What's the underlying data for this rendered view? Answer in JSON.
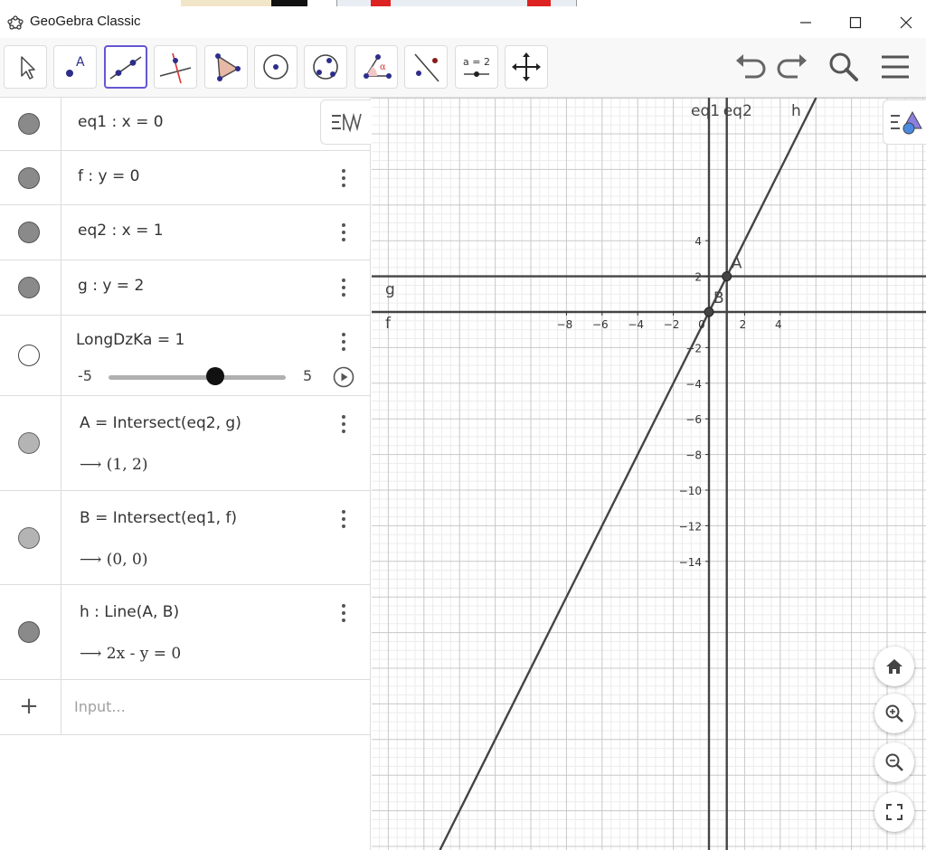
{
  "window": {
    "title": "GeoGebra Classic",
    "controls": [
      "minimize",
      "maximize",
      "close"
    ]
  },
  "toolbar": {
    "tools": [
      {
        "name": "move",
        "icon": "move-arrow-icon"
      },
      {
        "name": "point",
        "icon": "point-icon",
        "label": "A"
      },
      {
        "name": "line",
        "icon": "line-through-two-points-icon",
        "selected": true
      },
      {
        "name": "perpendicular-line",
        "icon": "perpendicular-line-icon"
      },
      {
        "name": "polygon",
        "icon": "polygon-icon"
      },
      {
        "name": "circle-center-point",
        "icon": "circle-icon"
      },
      {
        "name": "circle-three-points",
        "icon": "circle-three-points-icon"
      },
      {
        "name": "angle",
        "icon": "angle-icon",
        "label": "α"
      },
      {
        "name": "reflect-about-line",
        "icon": "reflect-icon"
      },
      {
        "name": "slider",
        "icon": "slider-icon",
        "label": "a = 2"
      },
      {
        "name": "move-graphics-view",
        "icon": "move-graphics-icon"
      }
    ],
    "right": [
      "undo",
      "redo",
      "search",
      "menu"
    ]
  },
  "algebra": {
    "rows": [
      {
        "id": "eq1",
        "expr": "eq1 : x = 0",
        "marble": "dark"
      },
      {
        "id": "f",
        "expr": "f : y = 0",
        "marble": "dark"
      },
      {
        "id": "eq2",
        "expr": "eq2 : x = 1",
        "marble": "dark"
      },
      {
        "id": "g",
        "expr": "g : y = 2",
        "marble": "dark"
      },
      {
        "id": "slider",
        "expr": "LongDzKa = 1",
        "marble": "empty",
        "slider": {
          "min": "-5",
          "max": "5",
          "value": 1,
          "min_value": -5,
          "max_value": 5
        }
      },
      {
        "id": "A",
        "expr": "A = Intersect(eq2, g)",
        "output": "⟶ (1, 2)",
        "marble": "light"
      },
      {
        "id": "B",
        "expr": "B = Intersect(eq1, f)",
        "output": "⟶ (0, 0)",
        "marble": "light"
      },
      {
        "id": "h",
        "expr": "h : Line(A, B)",
        "output": "⟶ 2x - y = 0",
        "marble": "dark"
      }
    ],
    "input_placeholder": "Input..."
  },
  "graphics": {
    "x_ticks": [
      "−8",
      "−6",
      "−4",
      "−2",
      "0",
      "2",
      "4"
    ],
    "x_tick_values": [
      -8,
      -6,
      -4,
      -2,
      0,
      2,
      4
    ],
    "y_ticks": [
      "4",
      "2",
      "−2",
      "−4",
      "−6",
      "−8",
      "−10",
      "−12",
      "−14"
    ],
    "y_tick_values": [
      4,
      2,
      -2,
      -4,
      -6,
      -8,
      -10,
      -12,
      -14
    ],
    "object_labels": {
      "eq1": "eq1",
      "eq2": "eq2",
      "h": "h",
      "g": "g",
      "f": "f",
      "A": "A",
      "B": "B"
    },
    "points": [
      {
        "label": "A",
        "x": 1,
        "y": 2
      },
      {
        "label": "B",
        "x": 0,
        "y": 0
      }
    ],
    "lines": [
      {
        "label": "eq1",
        "equation": "x = 0"
      },
      {
        "label": "eq2",
        "equation": "x = 1"
      },
      {
        "label": "f",
        "equation": "y = 0"
      },
      {
        "label": "g",
        "equation": "y = 2"
      },
      {
        "label": "h",
        "equation": "2x - y = 0"
      }
    ],
    "view_buttons": [
      "home",
      "zoom-in",
      "zoom-out",
      "fullscreen"
    ]
  },
  "colors": {
    "accent": "#6557d2",
    "object": "#444444",
    "grid_major": "#c8c8c8",
    "grid_minor": "#ececec"
  }
}
